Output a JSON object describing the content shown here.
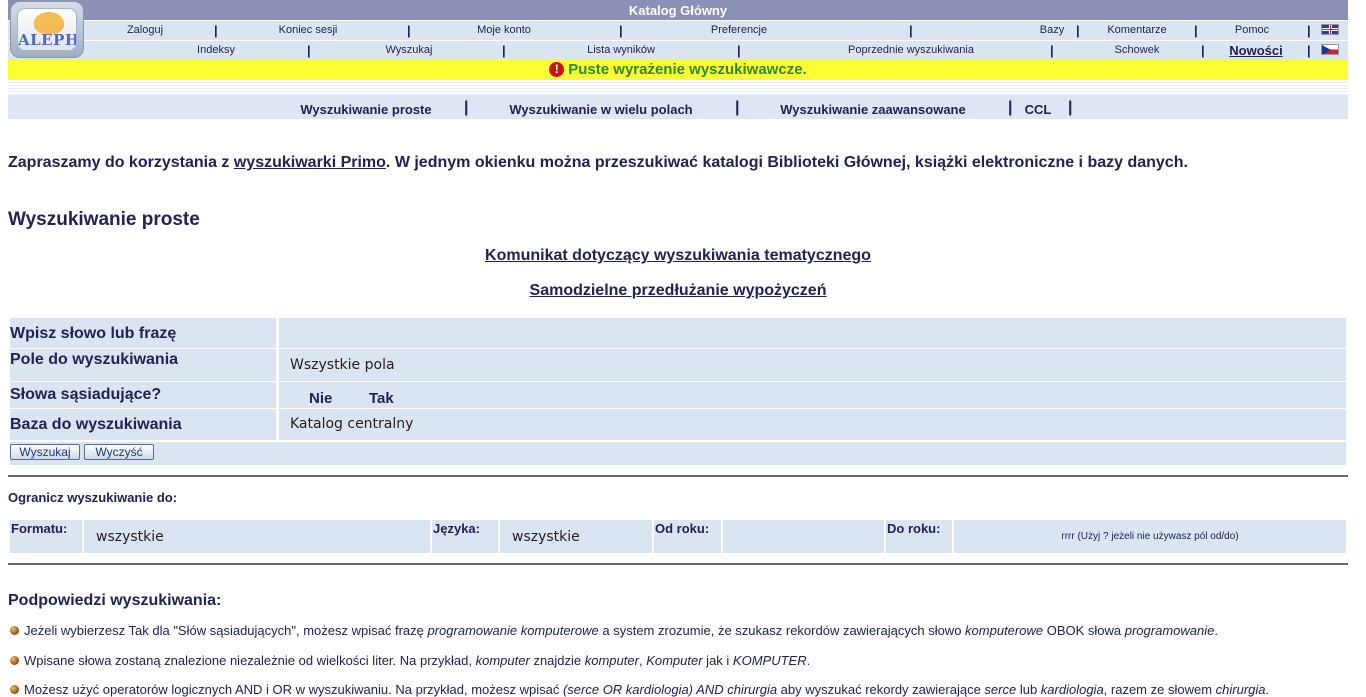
{
  "header": {
    "logo_text": "ALEPH",
    "title": "Katalog Główny",
    "nav_row1": [
      "Zaloguj",
      "Koniec sesji",
      "Moje konto",
      "Preferencje",
      "Bazy",
      "Komentarze",
      "Pomoc"
    ],
    "nav_row2": [
      "Indeksy",
      "Wyszukaj",
      "Lista wyników",
      "Poprzednie wyszukiwania",
      "Schowek",
      "Nowości"
    ],
    "separator": "|",
    "languages": [
      "english-flag",
      "czech-flag"
    ]
  },
  "message": {
    "icon": "exclamation-icon",
    "text": "Puste wyrażenie wyszukiwawcze."
  },
  "search_tabs": [
    "Wyszukiwanie proste",
    "Wyszukiwanie w wielu polach",
    "Wyszukiwanie zaawansowane",
    "CCL"
  ],
  "intro": {
    "before": "Zapraszamy do korzystania z ",
    "link": "wyszukiwarki Primo",
    "after": ". W jednym okienku można przeszukiwać katalogi Biblioteki Głównej, książki elektroniczne i bazy danych."
  },
  "section_title": "Wyszukiwanie proste",
  "notice_links": [
    "Komunikat dotyczący wyszukiwania tematycznego",
    "Samodzielne przedłużanie wypożyczeń"
  ],
  "form": {
    "query_label": "Wpisz słowo lub frazę",
    "query_value": "",
    "field_label": "Pole do wyszukiwania",
    "field_value": "Wszystkie pola",
    "adjacent_label": "Słowa sąsiadujące?",
    "adjacent_no": "Nie",
    "adjacent_yes": "Tak",
    "base_label": "Baza do wyszukiwania",
    "base_value": "Katalog centralny",
    "search_button": "Wyszukaj",
    "clear_button": "Wyczyść"
  },
  "limits": {
    "title": "Ogranicz wyszukiwanie do:",
    "format_label": "Formatu:",
    "format_value": "wszystkie",
    "language_label": "Języka:",
    "language_value": "wszystkie",
    "from_label": "Od roku:",
    "from_value": "",
    "to_label": "Do roku:",
    "to_value": "",
    "year_hint": "rrrr (Użyj ? jeżeli nie używasz pól od/do)"
  },
  "hints": {
    "title": "Podpowiedzi wyszukiwania:",
    "h1": {
      "a": "Jeżeli wybierzesz Tak dla \"Słów sąsiadujących\", możesz wpisać frazę ",
      "b": "programowanie komputerowe",
      "c": " a system zrozumie, że szukasz rekordów zawierających słowo ",
      "d": "komputerowe",
      "e": " OBOK słowa ",
      "f": "programowanie",
      "g": "."
    },
    "h2": {
      "a": "Wpisane słowa zostaną znalezione niezależnie od wielkości liter. Na przykład, ",
      "b": "komputer",
      "c": " znajdzie ",
      "d": "komputer",
      "e": ", ",
      "f": "Komputer",
      "g": " jak i ",
      "h": "KOMPUTER",
      "i": "."
    },
    "h3": {
      "a": "Możesz użyć operatorów logicznych AND i OR w wyszukiwaniu. Na przykład, możesz wpisać ",
      "b": "(serce OR kardiologia) AND chirurgia",
      "c": " aby wyszukać rekordy zawierające ",
      "d": "serce",
      "e": " lub ",
      "f": "kardiologia",
      "g": ", razem ze słowem ",
      "h": "chirurgia",
      "i": "."
    }
  }
}
